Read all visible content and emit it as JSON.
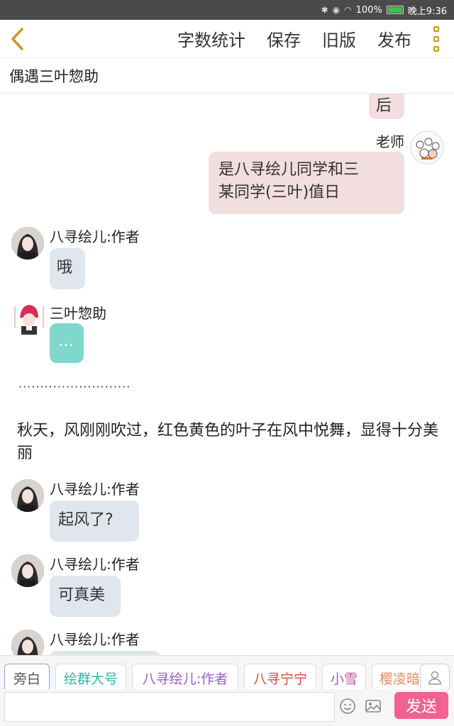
{
  "status": {
    "bluetooth": "bluetooth-icon",
    "battery_percent": 100,
    "battery": "100%",
    "time": "晚上9:36"
  },
  "toolbar": {
    "back": "‹",
    "menu": [
      "字数统计",
      "保存",
      "旧版",
      "发布"
    ]
  },
  "title": "偶遇三叶惣助",
  "messages": {
    "partial_right": "后",
    "teacher_name": "老师",
    "teacher_line1": "是八寻绘儿同学和三",
    "teacher_line2": "某同学(三叶)值日",
    "eri_name": "八寻绘儿:作者",
    "eri_1": "哦",
    "mitsuba_name": "三叶惣助",
    "mitsuba_1": "…",
    "dots": "··························",
    "narration": "秋天，风刚刚吹过，红色黄色的叶子在风中悦舞，显得十分美丽",
    "eri_2": "起风了?",
    "eri_3": "可真美"
  },
  "roles": [
    {
      "label": "旁白",
      "color": "#555555"
    },
    {
      "label": "绘群大号",
      "color": "#2fb5a5"
    },
    {
      "label": "八寻绘儿:作者",
      "color": "#9c5ac8"
    },
    {
      "label": "八寻宁宁",
      "color": "#d94a3a"
    },
    {
      "label": "小雪",
      "color": "#c050a0"
    },
    {
      "label": "樱凌暗",
      "color": "#e58a5a"
    }
  ],
  "input": {
    "send": "发送",
    "emoji_icon": "smile-icon",
    "image_icon": "image-icon"
  }
}
